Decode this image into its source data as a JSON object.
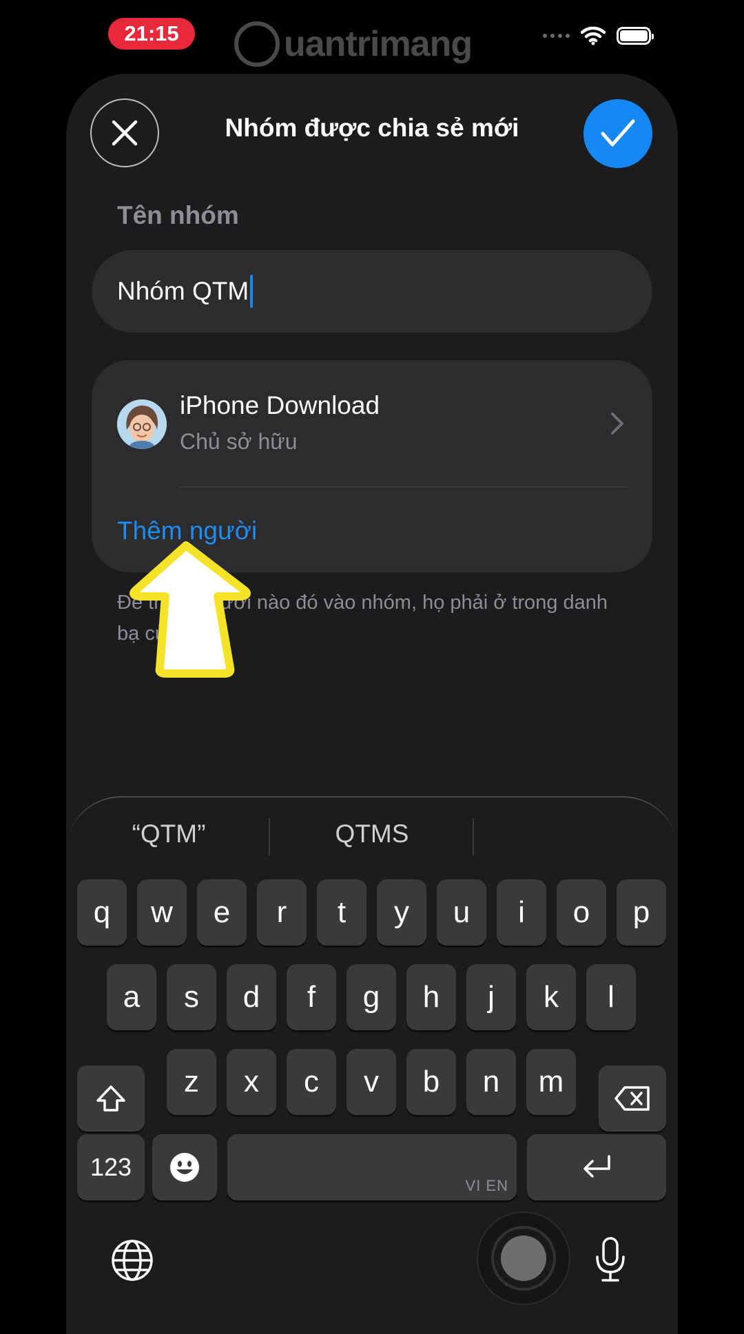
{
  "status_bar": {
    "time": "21:15",
    "watermark": "uantrimang"
  },
  "header": {
    "title": "Nhóm được chia sẻ mới",
    "close_icon": "close-icon",
    "done_icon": "checkmark-icon"
  },
  "group_name": {
    "label": "Tên nhóm",
    "value": "Nhóm QTM"
  },
  "members": {
    "items": [
      {
        "name": "iPhone Download",
        "role": "Chủ sở hữu"
      }
    ],
    "add_label": "Thêm người"
  },
  "hint_lines": [
    "Để thêm người nào đó vào nhóm, họ phải ở trong danh",
    "bạ của bạn."
  ],
  "keyboard": {
    "suggestions": [
      "“QTM”",
      "QTMS",
      ""
    ],
    "rows": [
      [
        "q",
        "w",
        "e",
        "r",
        "t",
        "y",
        "u",
        "i",
        "o",
        "p"
      ],
      [
        "a",
        "s",
        "d",
        "f",
        "g",
        "h",
        "j",
        "k",
        "l"
      ],
      [
        "z",
        "x",
        "c",
        "v",
        "b",
        "n",
        "m"
      ]
    ],
    "numbers_label": "123",
    "space_langs": "VI EN",
    "accent": "#1688f3"
  }
}
